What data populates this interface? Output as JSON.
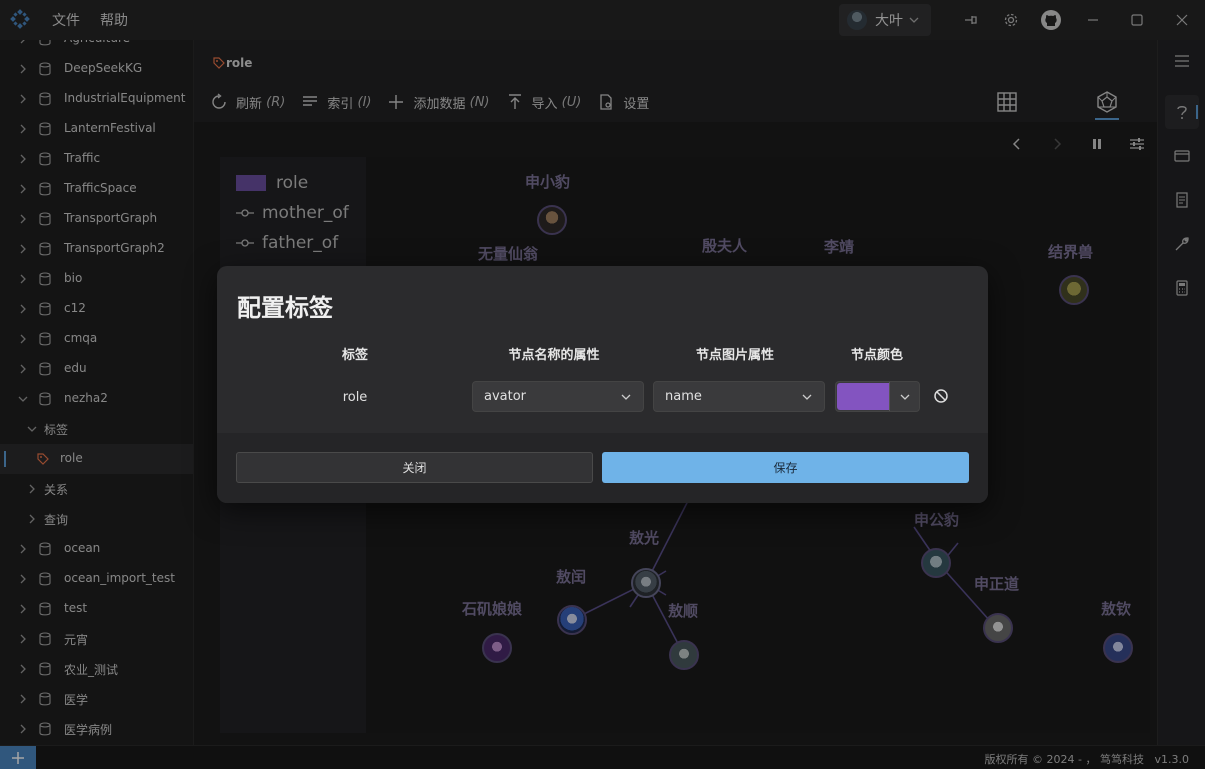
{
  "menu": {
    "file": "文件",
    "help": "帮助"
  },
  "user": {
    "name": "大叶"
  },
  "sidebar": {
    "items": [
      {
        "label": "Agriculture",
        "kind": "db"
      },
      {
        "label": "DeepSeekKG",
        "kind": "db"
      },
      {
        "label": "IndustrialEquipment",
        "kind": "db"
      },
      {
        "label": "LanternFestival",
        "kind": "db"
      },
      {
        "label": "Traffic",
        "kind": "db"
      },
      {
        "label": "TrafficSpace",
        "kind": "db"
      },
      {
        "label": "TransportGraph",
        "kind": "db"
      },
      {
        "label": "TransportGraph2",
        "kind": "db"
      },
      {
        "label": "bio",
        "kind": "db"
      },
      {
        "label": "c12",
        "kind": "db"
      },
      {
        "label": "cmqa",
        "kind": "db"
      },
      {
        "label": "edu",
        "kind": "db"
      },
      {
        "label": "nezha2",
        "kind": "db-open"
      },
      {
        "label": "标签",
        "kind": "sub-open"
      },
      {
        "label": "role",
        "kind": "tag-selected"
      },
      {
        "label": "关系",
        "kind": "sub"
      },
      {
        "label": "查询",
        "kind": "sub"
      },
      {
        "label": "ocean",
        "kind": "db"
      },
      {
        "label": "ocean_import_test",
        "kind": "db"
      },
      {
        "label": "test",
        "kind": "db"
      },
      {
        "label": "元宵",
        "kind": "db"
      },
      {
        "label": "农业_测试",
        "kind": "db"
      },
      {
        "label": "医学",
        "kind": "db"
      },
      {
        "label": "医学病例",
        "kind": "db"
      }
    ]
  },
  "tab": {
    "label": "role"
  },
  "toolbar": {
    "refresh": "刷新",
    "refresh_key": "(R)",
    "index": "索引",
    "index_key": "(I)",
    "add": "添加数据",
    "add_key": "(N)",
    "import": "导入",
    "import_key": "(U)",
    "settings": "设置"
  },
  "legend": {
    "items": [
      {
        "label": "role",
        "kind": "node"
      },
      {
        "label": "mother_of",
        "kind": "edge"
      },
      {
        "label": "father_of",
        "kind": "edge"
      }
    ]
  },
  "graph": {
    "nodes": [
      {
        "label": "申小豹",
        "has_avatar": true
      },
      {
        "label": "无量仙翁",
        "has_avatar": false
      },
      {
        "label": "殷夫人",
        "has_avatar": false
      },
      {
        "label": "李靖",
        "has_avatar": false
      },
      {
        "label": "结界兽",
        "has_avatar": true
      },
      {
        "label": "敖光",
        "has_avatar": true
      },
      {
        "label": "敖闰",
        "has_avatar": true
      },
      {
        "label": "石矶娘娘",
        "has_avatar": true
      },
      {
        "label": "敖顺",
        "has_avatar": true
      },
      {
        "label": "申公豹",
        "has_avatar": true
      },
      {
        "label": "申正道",
        "has_avatar": true
      },
      {
        "label": "敖钦",
        "has_avatar": true
      }
    ],
    "colors": {
      "node_label": "#7d7499",
      "edge": "#5a4f8a"
    }
  },
  "modal": {
    "title": "配置标签",
    "columns": {
      "label": "标签",
      "name_prop": "节点名称的属性",
      "image_prop": "节点图片属性",
      "color": "节点颜色"
    },
    "row": {
      "label": "role",
      "name_prop_value": "avator",
      "image_prop_value": "name",
      "color_value": "#8354c0"
    },
    "close_label": "关闭",
    "save_label": "保存"
  },
  "status": {
    "copyright": "版权所有 © 2024 - ， 笃笃科技",
    "version": "v1.3.0"
  },
  "colors": {
    "accent": "#5b9bd5",
    "save_button": "#6fb3e8",
    "role_swatch": "#6a4fa0"
  }
}
